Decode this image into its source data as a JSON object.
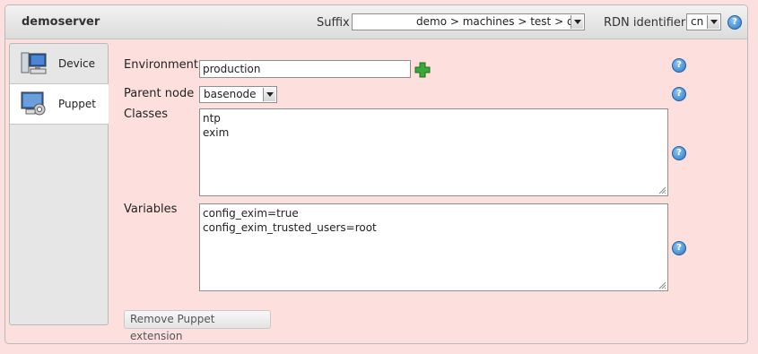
{
  "header": {
    "title": "demoserver",
    "suffix_label": "Suffix",
    "suffix_value": "demo > machines > test > de",
    "rdn_label": "RDN identifier",
    "rdn_value": "cn"
  },
  "tabs": [
    {
      "label": "Device",
      "icon": "computer-icon"
    },
    {
      "label": "Puppet",
      "icon": "puppet-gear-icon"
    }
  ],
  "form": {
    "environment_label": "Environment",
    "environment_value": "production",
    "parent_label": "Parent node",
    "parent_value": "basenode",
    "classes_label": "Classes",
    "classes_value": "ntp\nexim",
    "variables_label": "Variables",
    "variables_value": "config_exim=true\nconfig_exim_trusted_users=root",
    "remove_button": "Remove Puppet extension"
  },
  "colors": {
    "background": "#fde0de",
    "help_icon": "#2a78c6",
    "add_icon": "#3aa83a"
  }
}
